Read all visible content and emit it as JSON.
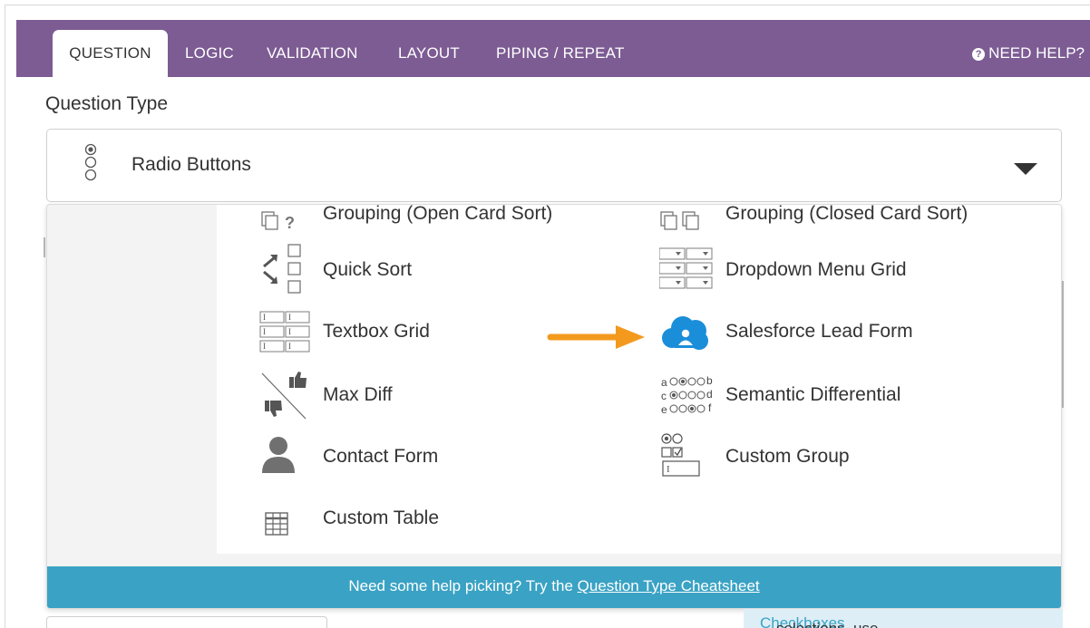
{
  "tabs": [
    {
      "label": "QUESTION",
      "active": true
    },
    {
      "label": "LOGIC"
    },
    {
      "label": "VALIDATION"
    },
    {
      "label": "LAYOUT"
    },
    {
      "label": "PIPING / REPEAT"
    }
  ],
  "help_link": "NEED HELP?",
  "question_type_label": "Question Type",
  "select": {
    "value": "Radio Buttons",
    "icon": "radio-buttons-icon"
  },
  "options": [
    {
      "label": "Grouping (Open Card Sort)",
      "icon": "open-card-sort-icon"
    },
    {
      "label": "Grouping (Closed Card Sort)",
      "icon": "closed-card-sort-icon"
    },
    {
      "label": "Quick Sort",
      "icon": "quick-sort-icon"
    },
    {
      "label": "Dropdown Menu Grid",
      "icon": "dropdown-grid-icon"
    },
    {
      "label": "Textbox Grid",
      "icon": "textbox-grid-icon"
    },
    {
      "label": "Salesforce Lead Form",
      "icon": "salesforce-cloud-icon"
    },
    {
      "label": "Max Diff",
      "icon": "max-diff-icon"
    },
    {
      "label": "Semantic Differential",
      "icon": "semantic-differential-icon"
    },
    {
      "label": "Contact Form",
      "icon": "contact-person-icon"
    },
    {
      "label": "Custom Group",
      "icon": "custom-group-icon"
    },
    {
      "label": "Custom Table",
      "icon": "table-grid-icon"
    }
  ],
  "help_bar": {
    "text": "Need some help picking? Try the ",
    "link": "Question Type Cheatsheet"
  },
  "behind_tip": {
    "text": "selections, use ",
    "link": "Checkboxes"
  },
  "colors": {
    "tabbar": "#7c5c93",
    "help_bar": "#3aa2c4",
    "arrow": "#f39a1e",
    "salesforce": "#1b8ed9"
  }
}
